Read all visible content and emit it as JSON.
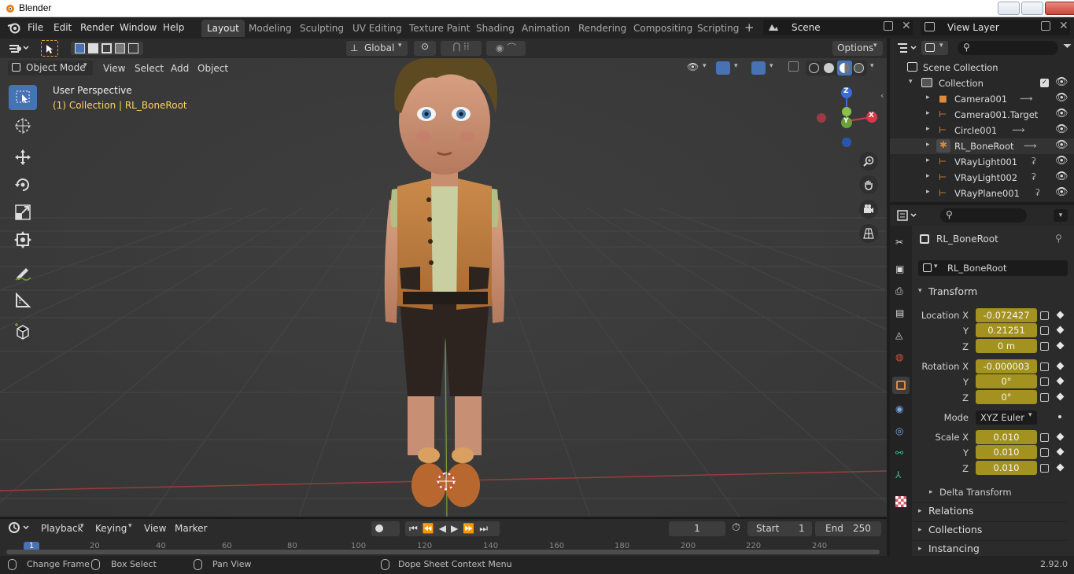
{
  "window": {
    "title": "Blender"
  },
  "menu": [
    "File",
    "Edit",
    "Render",
    "Window",
    "Help"
  ],
  "workspace_tabs": [
    "Layout",
    "Modeling",
    "Sculpting",
    "UV Editing",
    "Texture Paint",
    "Shading",
    "Animation",
    "Rendering",
    "Compositing",
    "Scripting"
  ],
  "active_tab": "Layout",
  "scene": "Scene",
  "view_layer": "View Layer",
  "tool_header": {
    "orientation": "Global",
    "options": "Options"
  },
  "viewport_header": {
    "mode": "Object Mode",
    "menus": [
      "View",
      "Select",
      "Add",
      "Object"
    ]
  },
  "viewport": {
    "view_name": "User Perspective",
    "context": "(1) Collection | RL_BoneRoot",
    "gizmo": {
      "x": "X",
      "y": "Y",
      "z": "Z"
    }
  },
  "outliner": {
    "scene_collection": "Scene Collection",
    "collection": "Collection",
    "objects": [
      "Camera001",
      "Camera001.Target",
      "Circle001",
      "RL_BoneRoot",
      "VRayLight001",
      "VRayLight002",
      "VRayPlane001"
    ]
  },
  "properties": {
    "object_name": "RL_BoneRoot",
    "datablock": "RL_BoneRoot",
    "transform_title": "Transform",
    "location_label": "Location X",
    "location": [
      "-0.072427",
      "0.21251",
      "0 m"
    ],
    "rotation_label": "Rotation X",
    "rotation": [
      "-0.000003",
      "0°",
      "0°"
    ],
    "axis_y": "Y",
    "axis_z": "Z",
    "mode_label": "Mode",
    "mode": "XYZ Euler",
    "scale_label": "Scale X",
    "scale": [
      "0.010",
      "0.010",
      "0.010"
    ],
    "delta": "Delta Transform",
    "sections": [
      "Relations",
      "Collections",
      "Instancing"
    ]
  },
  "timeline": {
    "menus": [
      "Playback",
      "Keying",
      "View",
      "Marker"
    ],
    "current_frame": "1",
    "start_label": "Start",
    "start": "1",
    "end_label": "End",
    "end": "250",
    "ruler": [
      "1",
      "20",
      "40",
      "60",
      "80",
      "100",
      "120",
      "140",
      "160",
      "180",
      "200",
      "220",
      "240"
    ]
  },
  "statusbar": {
    "items": [
      "Change Frame",
      "Box Select",
      "Pan View",
      "Dope Sheet Context Menu"
    ],
    "version": "2.92.0"
  },
  "colors": {
    "accent": "#4772b3",
    "field_yellow": "#a3921f",
    "context_text": "#ffd35c"
  }
}
